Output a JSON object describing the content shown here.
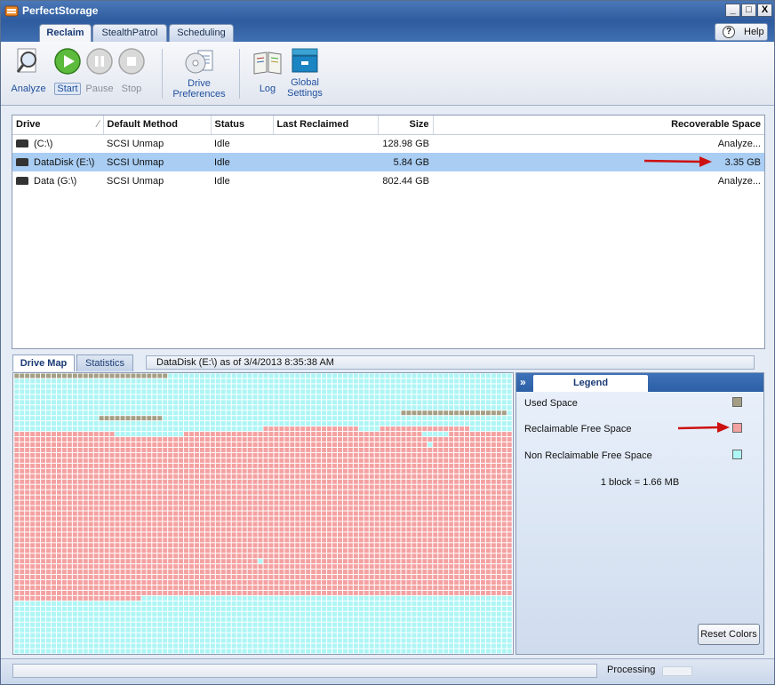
{
  "app": {
    "title": "PerfectStorage"
  },
  "window_controls": {
    "minimize": "_",
    "maximize": "□",
    "close": "X"
  },
  "ribbon_tabs": [
    "Reclaim",
    "StealthPatrol",
    "Scheduling"
  ],
  "help": {
    "label": "Help",
    "glyph": "?"
  },
  "toolbar": {
    "analyze": "Analyze",
    "start": "Start",
    "pause": "Pause",
    "stop": "Stop",
    "drive_prefs_line1": "Drive",
    "drive_prefs_line2": "Preferences",
    "log": "Log",
    "global_line1": "Global",
    "global_line2": "Settings"
  },
  "grid": {
    "columns": [
      "Drive",
      "Default Method",
      "Status",
      "Last Reclaimed",
      "Size",
      "Recoverable Space"
    ],
    "rows": [
      {
        "drive": "(C:\\)",
        "method": "SCSI Unmap",
        "status": "Idle",
        "last": "",
        "size": "128.98 GB",
        "recoverable": "Analyze..."
      },
      {
        "drive": "DataDisk (E:\\)",
        "method": "SCSI Unmap",
        "status": "Idle",
        "last": "",
        "size": "5.84 GB",
        "recoverable": "3.35 GB"
      },
      {
        "drive": "Data (G:\\)",
        "method": "SCSI Unmap",
        "status": "Idle",
        "last": "",
        "size": "802.44 GB",
        "recoverable": "Analyze..."
      }
    ],
    "selected_row": 1
  },
  "bottom_tabs": [
    "Drive Map",
    "Statistics"
  ],
  "map_status": "DataDisk (E:\\) as of 3/4/2013 8:35:38 AM",
  "legend": {
    "title": "Legend",
    "items": [
      {
        "label": "Used Space",
        "color": "#a49e85"
      },
      {
        "label": "Reclaimable Free Space",
        "color": "#f4a1a1"
      },
      {
        "label": "Non Reclaimable Free Space",
        "color": "#aef5f5"
      }
    ],
    "block_note": "1 block = 1.66 MB",
    "reset": "Reset Colors"
  },
  "status_bar": {
    "text": "Processing"
  },
  "colors": {
    "used": "#a49e85",
    "reclaimable": "#f4a1a1",
    "nonreclaimable": "#aef5f5",
    "accent": "#2e5c9e",
    "arrow": "#cc1111"
  }
}
